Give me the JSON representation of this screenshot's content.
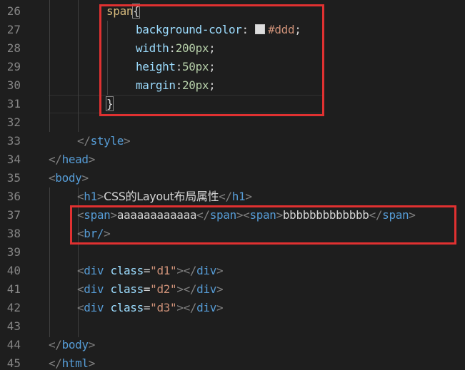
{
  "editor": {
    "lines": [
      {
        "num": "26",
        "parts": [
          {
            "t": "span",
            "c": "sel"
          },
          {
            "t": "{",
            "c": "txt"
          }
        ]
      },
      {
        "num": "27",
        "parts": [
          {
            "t": "background-color",
            "c": "attr"
          },
          {
            "t": ": ",
            "c": "txt"
          },
          {
            "t": "#ddd",
            "c": "str",
            "swatch": "#dddddd"
          },
          {
            "t": ";",
            "c": "txt"
          }
        ]
      },
      {
        "num": "28",
        "parts": [
          {
            "t": "width",
            "c": "attr"
          },
          {
            "t": ":",
            "c": "txt"
          },
          {
            "t": "200px",
            "c": "num"
          },
          {
            "t": ";",
            "c": "txt"
          }
        ]
      },
      {
        "num": "29",
        "parts": [
          {
            "t": "height",
            "c": "attr"
          },
          {
            "t": ":",
            "c": "txt"
          },
          {
            "t": "50px",
            "c": "num"
          },
          {
            "t": ";",
            "c": "txt"
          }
        ]
      },
      {
        "num": "30",
        "parts": [
          {
            "t": "margin",
            "c": "attr"
          },
          {
            "t": ":",
            "c": "txt"
          },
          {
            "t": "20px",
            "c": "num"
          },
          {
            "t": ";",
            "c": "txt"
          }
        ]
      },
      {
        "num": "31",
        "parts": [
          {
            "t": "}",
            "c": "txt"
          }
        ]
      },
      {
        "num": "32",
        "parts": []
      },
      {
        "num": "33",
        "parts": [
          {
            "t": "</",
            "c": "punc"
          },
          {
            "t": "style",
            "c": "tag"
          },
          {
            "t": ">",
            "c": "punc"
          }
        ]
      },
      {
        "num": "34",
        "parts": [
          {
            "t": "</",
            "c": "punc"
          },
          {
            "t": "head",
            "c": "tag"
          },
          {
            "t": ">",
            "c": "punc"
          }
        ]
      },
      {
        "num": "35",
        "parts": [
          {
            "t": "<",
            "c": "punc"
          },
          {
            "t": "body",
            "c": "tag"
          },
          {
            "t": ">",
            "c": "punc"
          }
        ]
      },
      {
        "num": "36",
        "parts": [
          {
            "t": "<",
            "c": "punc"
          },
          {
            "t": "h1",
            "c": "tag"
          },
          {
            "t": ">",
            "c": "punc"
          },
          {
            "t": "CSS的Layout布局属性",
            "c": "txt"
          },
          {
            "t": "</",
            "c": "punc"
          },
          {
            "t": "h1",
            "c": "tag"
          },
          {
            "t": ">",
            "c": "punc"
          }
        ]
      },
      {
        "num": "37",
        "parts": [
          {
            "t": "<",
            "c": "punc"
          },
          {
            "t": "span",
            "c": "tag"
          },
          {
            "t": ">",
            "c": "punc"
          },
          {
            "t": "aaaaaaaaaaaa",
            "c": "txt"
          },
          {
            "t": "</",
            "c": "punc"
          },
          {
            "t": "span",
            "c": "tag"
          },
          {
            "t": ">",
            "c": "punc"
          },
          {
            "t": "<",
            "c": "punc"
          },
          {
            "t": "span",
            "c": "tag"
          },
          {
            "t": ">",
            "c": "punc"
          },
          {
            "t": "bbbbbbbbbbbbb",
            "c": "txt"
          },
          {
            "t": "</",
            "c": "punc"
          },
          {
            "t": "span",
            "c": "tag"
          },
          {
            "t": ">",
            "c": "punc"
          }
        ]
      },
      {
        "num": "38",
        "parts": [
          {
            "t": "<",
            "c": "punc"
          },
          {
            "t": "br/",
            "c": "tag"
          },
          {
            "t": ">",
            "c": "punc"
          }
        ]
      },
      {
        "num": "39",
        "parts": []
      },
      {
        "num": "40",
        "parts": [
          {
            "t": "<",
            "c": "punc"
          },
          {
            "t": "div",
            "c": "tag"
          },
          {
            "t": " ",
            "c": "txt"
          },
          {
            "t": "class",
            "c": "attr"
          },
          {
            "t": "=",
            "c": "txt"
          },
          {
            "t": "\"d1\"",
            "c": "str"
          },
          {
            "t": "></",
            "c": "punc"
          },
          {
            "t": "div",
            "c": "tag"
          },
          {
            "t": ">",
            "c": "punc"
          }
        ]
      },
      {
        "num": "41",
        "parts": [
          {
            "t": "<",
            "c": "punc"
          },
          {
            "t": "div",
            "c": "tag"
          },
          {
            "t": " ",
            "c": "txt"
          },
          {
            "t": "class",
            "c": "attr"
          },
          {
            "t": "=",
            "c": "txt"
          },
          {
            "t": "\"d2\"",
            "c": "str"
          },
          {
            "t": "></",
            "c": "punc"
          },
          {
            "t": "div",
            "c": "tag"
          },
          {
            "t": ">",
            "c": "punc"
          }
        ]
      },
      {
        "num": "42",
        "parts": [
          {
            "t": "<",
            "c": "punc"
          },
          {
            "t": "div",
            "c": "tag"
          },
          {
            "t": " ",
            "c": "txt"
          },
          {
            "t": "class",
            "c": "attr"
          },
          {
            "t": "=",
            "c": "txt"
          },
          {
            "t": "\"d3\"",
            "c": "str"
          },
          {
            "t": "></",
            "c": "punc"
          },
          {
            "t": "div",
            "c": "tag"
          },
          {
            "t": ">",
            "c": "punc"
          }
        ]
      },
      {
        "num": "43",
        "parts": []
      },
      {
        "num": "44",
        "parts": [
          {
            "t": "</",
            "c": "punc"
          },
          {
            "t": "body",
            "c": "tag"
          },
          {
            "t": ">",
            "c": "punc"
          }
        ]
      },
      {
        "num": "45",
        "parts": [
          {
            "t": "</",
            "c": "punc"
          },
          {
            "t": "html",
            "c": "tag"
          },
          {
            "t": ">",
            "c": "punc"
          }
        ]
      }
    ]
  },
  "colors": {
    "background": "#1e1e1e",
    "line_number": "#858585",
    "tag": "#569cd6",
    "attribute": "#9cdcfe",
    "string": "#ce9178",
    "number": "#b5cea8",
    "selector": "#d7ba7d",
    "highlight_box": "#e03131"
  }
}
